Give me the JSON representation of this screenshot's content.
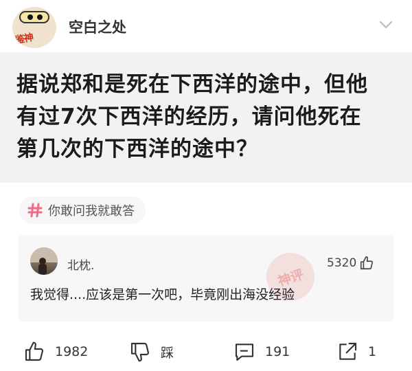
{
  "header": {
    "avatar_badge": "鉴神",
    "username": "空白之处"
  },
  "question": {
    "lines": [
      "据说郑和是死在下西洋的途中，但他",
      "有过7次下西洋的经历，请问他死在",
      "第几次的下西洋的途中？"
    ]
  },
  "topic": {
    "icon": "hash-icon",
    "label": "你敢问我就敢答",
    "color": "#f06a8a"
  },
  "comment": {
    "author": "北枕.",
    "likes": "5320",
    "text": "我觉得....应该是第一次吧，毕竟刚出海没经验",
    "stamp": "神评"
  },
  "actions": {
    "like_count": "1982",
    "dislike_label": "踩",
    "comment_count": "191",
    "share_count": "1"
  }
}
